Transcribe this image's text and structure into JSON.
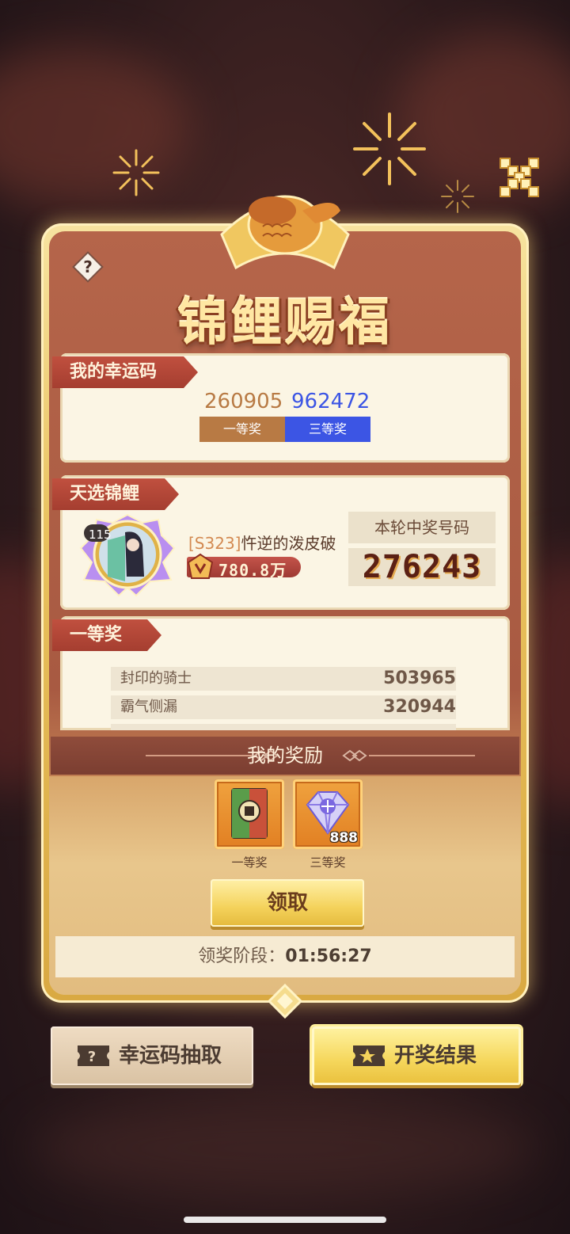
{
  "title": "锦鲤赐福",
  "lucky_codes": {
    "heading": "我的幸运码",
    "codes": [
      {
        "code": "260905",
        "prize": "一等奖",
        "color": "#b87a44"
      },
      {
        "code": "962472",
        "prize": "三等奖",
        "color": "#3c55e4"
      }
    ]
  },
  "koi": {
    "heading": "天选锦鲤",
    "level": "115",
    "server": "[S323]",
    "name": "忤逆的泼皮破",
    "power": "780.8万",
    "win_label": "本轮中奖号码",
    "win_number": "276243"
  },
  "first_prize": {
    "heading": "一等奖",
    "rows": [
      {
        "name": "封印的骑士",
        "code": "503965"
      },
      {
        "name": "霸气侧漏",
        "code": "320944"
      }
    ]
  },
  "rewards": {
    "heading": "我的奖励",
    "items": [
      {
        "label": "一等奖",
        "icon": "card-pack-icon",
        "count": ""
      },
      {
        "label": "三等奖",
        "icon": "diamond-icon",
        "count": "888"
      }
    ],
    "claim_label": "领取"
  },
  "stage": {
    "label": "领奖阶段：",
    "time": "01:56:27"
  },
  "buttons": {
    "lucky_draw": "幸运码抽取",
    "results": "开奖结果"
  },
  "colors": {
    "ribbon": "#b4473a",
    "panel": "#ab5c44",
    "gold": "#f4d25b"
  }
}
